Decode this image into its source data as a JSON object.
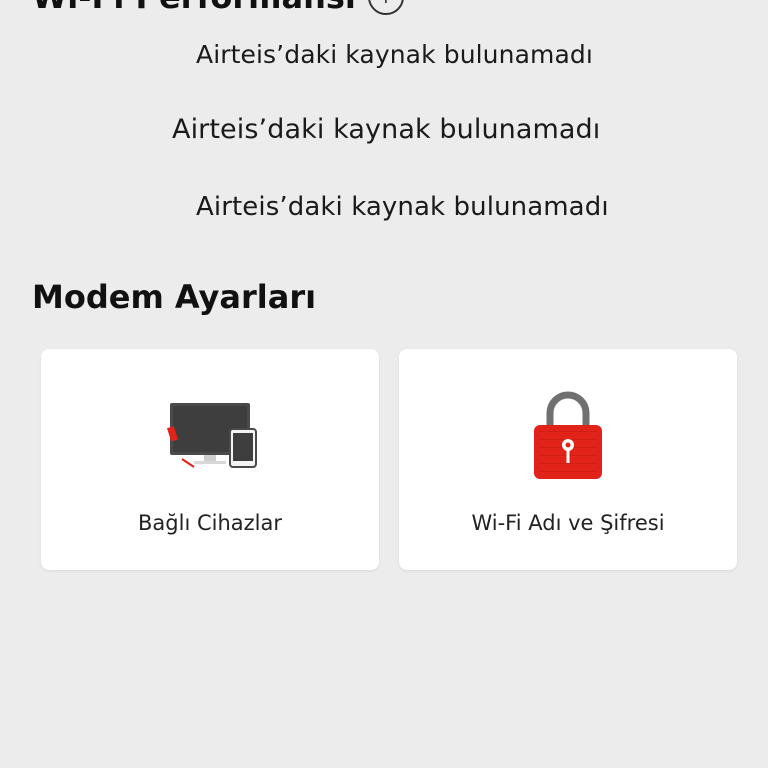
{
  "wifi_section": {
    "title": "Wi-Fi Performansı",
    "info_icon": "info-icon",
    "messages": [
      "Airteis’daki kaynak bulunamadı",
      "Airteis’daki kaynak bulunamadı",
      "Airteis’daki kaynak bulunamadı"
    ]
  },
  "modem_section": {
    "title": "Modem Ayarları",
    "cards": [
      {
        "label": "Bağlı Cihazlar",
        "icon": "devices-icon"
      },
      {
        "label": "Wi-Fi Adı ve Şifresi",
        "icon": "lock-icon"
      }
    ]
  },
  "colors": {
    "background": "#ececec",
    "card": "#ffffff",
    "accent_red": "#e2231a"
  }
}
